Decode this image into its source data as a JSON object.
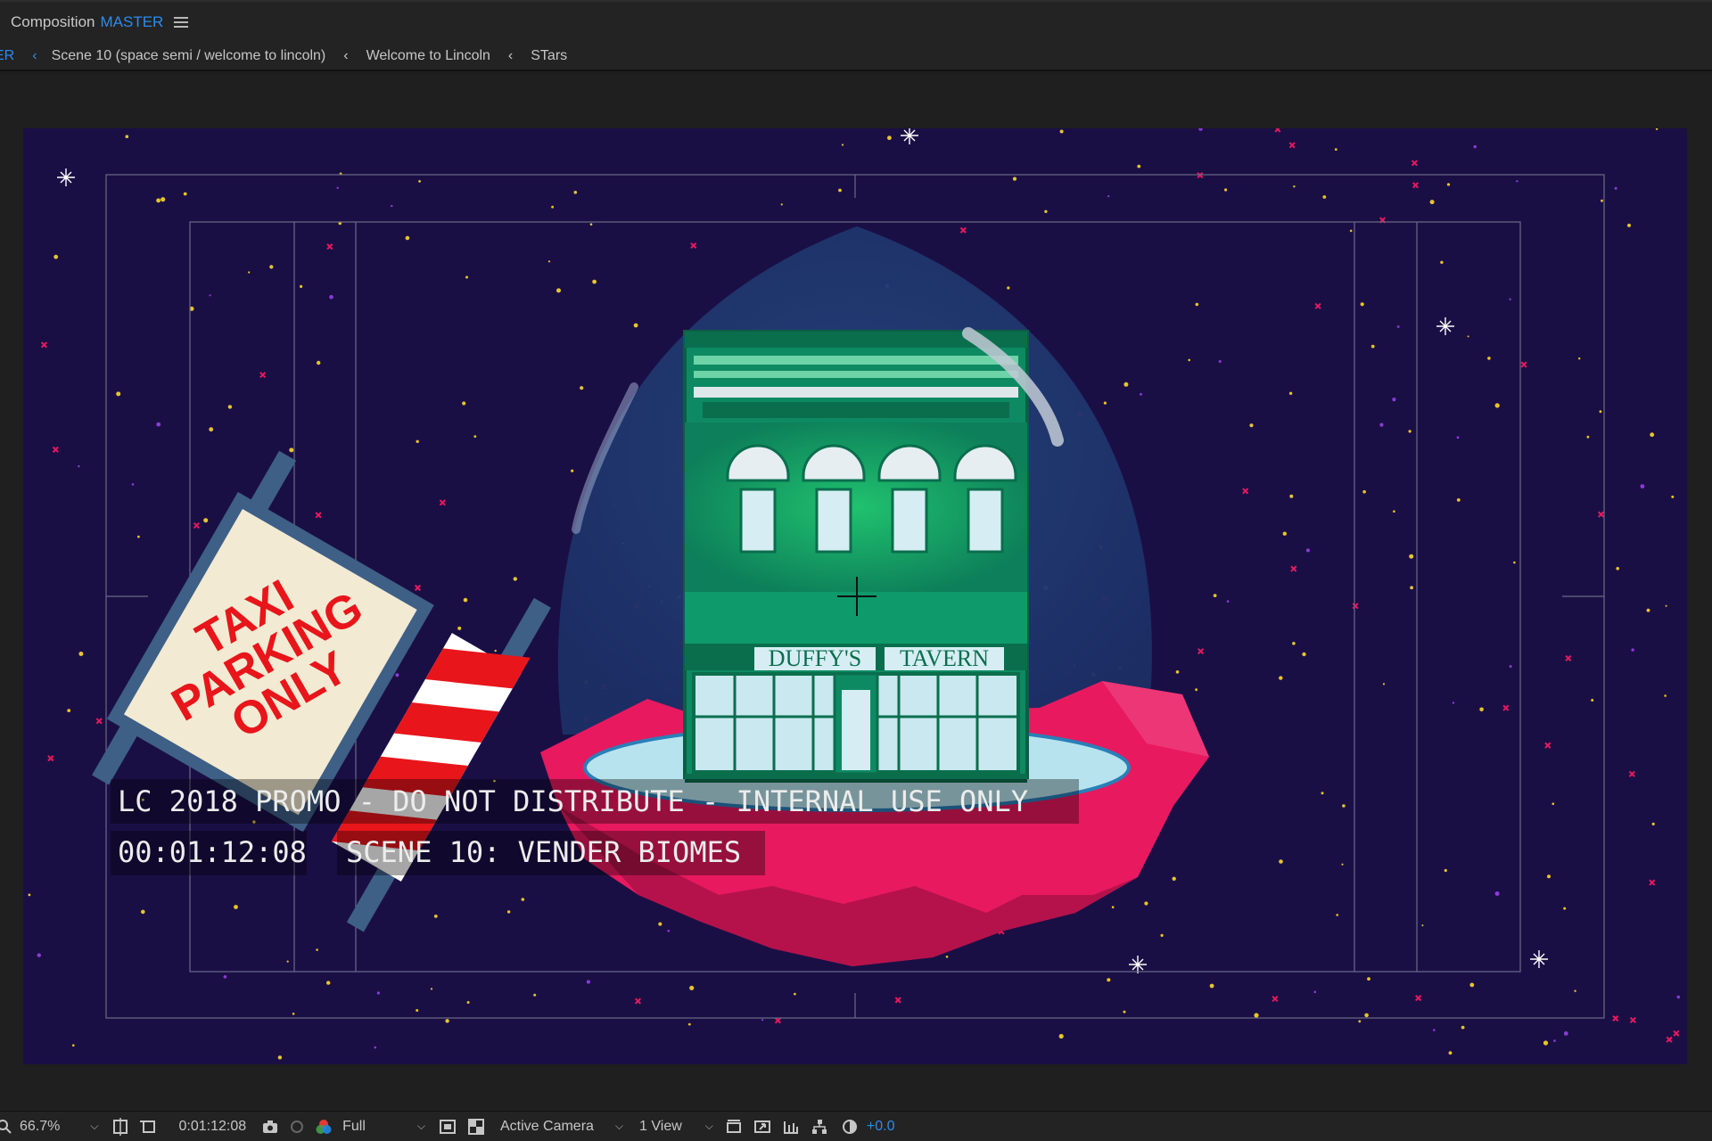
{
  "panel": {
    "label": "Composition",
    "comp_name": "MASTER"
  },
  "breadcrumb": {
    "items": [
      "ER",
      "Scene 10 (space semi / welcome to lincoln)",
      "Welcome to Lincoln",
      "STars"
    ]
  },
  "overlay": {
    "promo": "LC 2018 PROMO - DO NOT DISTRIBUTE - INTERNAL USE ONLY",
    "timecode": "00:01:12:08",
    "scene": "SCENE 10: VENDER BIOMES"
  },
  "artwork": {
    "sign_line1": "TAXI",
    "sign_line2": "PARKING",
    "sign_line3": "ONLY",
    "store_sign_left": "DUFFY'S",
    "store_sign_right": "TAVERN"
  },
  "toolbar": {
    "zoom": "66.7%",
    "current_time": "0:01:12:08",
    "resolution": "Full",
    "camera": "Active Camera",
    "views": "1 View",
    "exposure": "+0.0"
  },
  "colors": {
    "accent": "#2d8ceb",
    "canvas_bg": "#1a0f45",
    "bubble": "#1f3a6e",
    "rock": "#e8195f",
    "tavern_green": "#11906a",
    "sign_red": "#e8151b"
  }
}
